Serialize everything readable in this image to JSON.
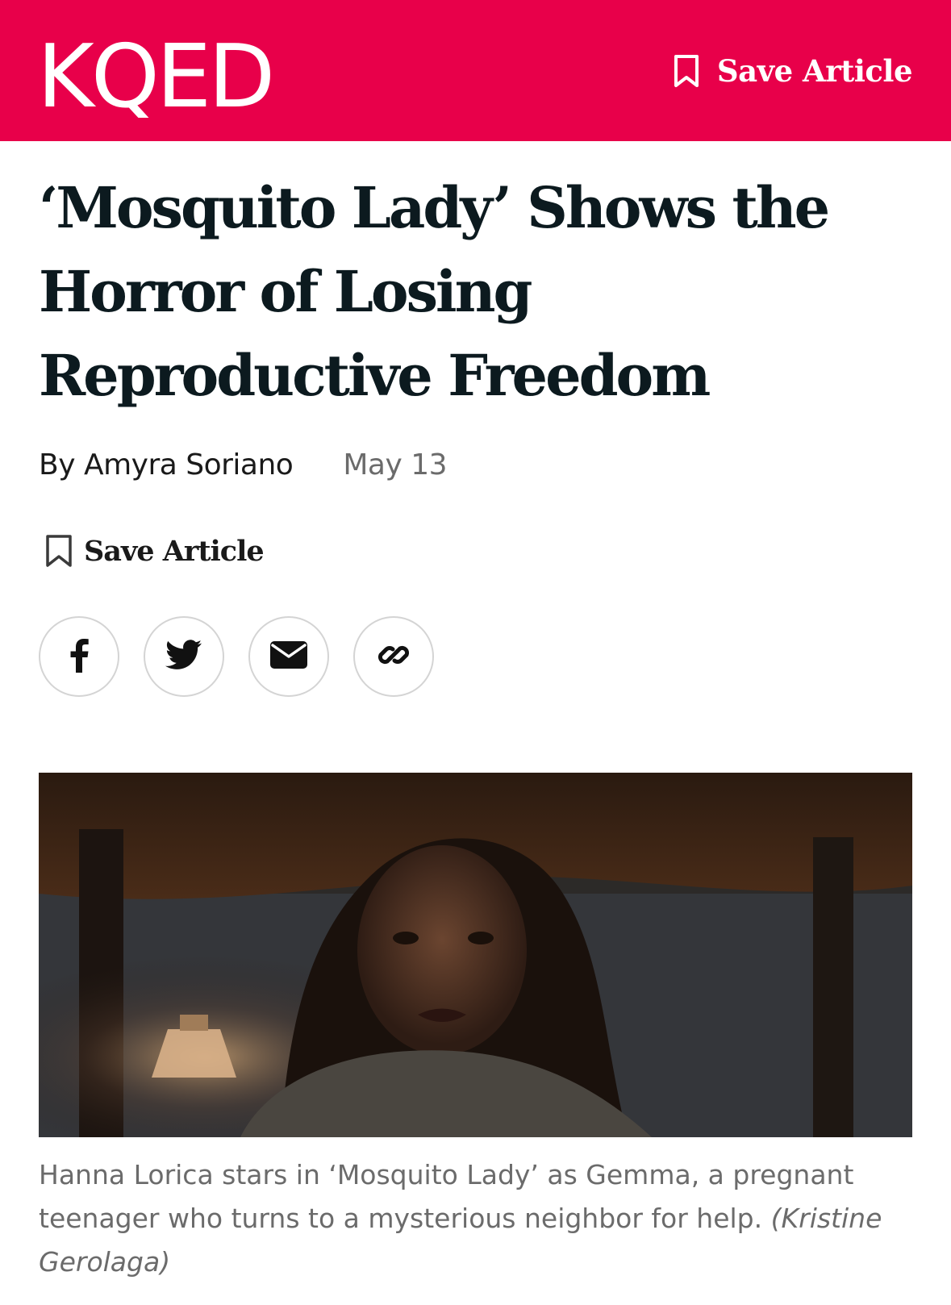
{
  "header": {
    "logo_text": "KQED",
    "save_label": "Save Article",
    "background_color": "#e8004a"
  },
  "article": {
    "headline": "‘Mosquito Lady’ Shows the Horror of Losing Reproductive Freedom",
    "author": "By Amyra Soriano",
    "date": "May 13",
    "save_label": "Save Article"
  },
  "share": {
    "buttons": [
      {
        "name": "facebook",
        "icon": "facebook-icon"
      },
      {
        "name": "twitter",
        "icon": "twitter-icon"
      },
      {
        "name": "email",
        "icon": "envelope-icon"
      },
      {
        "name": "copy-link",
        "icon": "link-icon"
      }
    ]
  },
  "hero_image": {
    "caption": "Hanna Lorica stars in ‘Mosquito Lady’ as Gemma, a pregnant teenager who turns to a mysterious neighbor for help.",
    "credit": "(Kristine Gerolaga)"
  }
}
